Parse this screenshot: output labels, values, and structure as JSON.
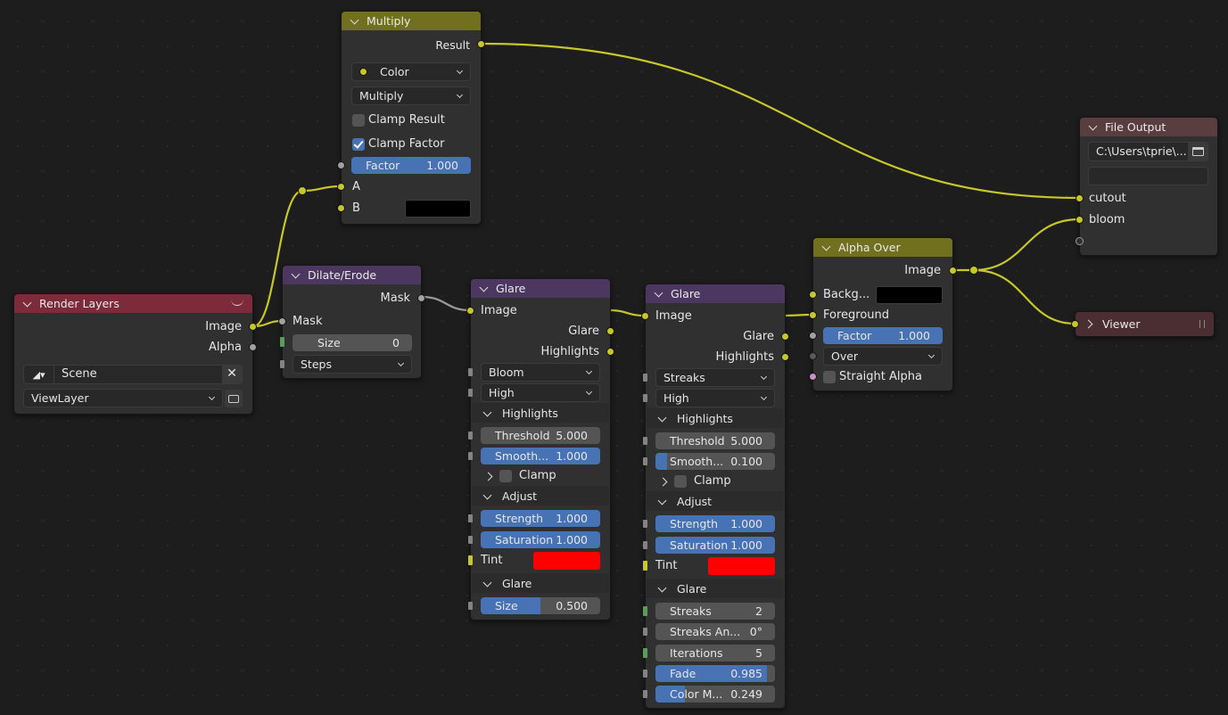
{
  "colors": {
    "background": "#1d1d1d",
    "node_body": "#303030",
    "header_math": "#71701f",
    "header_input": "#7d2a3b",
    "header_filter": "#4c3761",
    "header_output": "#5a3d3f",
    "header_viewer": "#4a2e31",
    "socket_color": "#c7c729",
    "socket_float": "#a1a1a1",
    "socket_shader": "#cc8ec7",
    "slider_blue": "#4772b3",
    "field_grey": "#545454",
    "wire_color": "#c7c729",
    "wire_float": "#9a9a9a",
    "tint_red": "#ff0000",
    "black": "#000000"
  },
  "multiply": {
    "title": "Multiply",
    "output_result": "Result",
    "data_type": "Color",
    "blend_mode": "Multiply",
    "clamp_result_label": "Clamp Result",
    "clamp_result_checked": false,
    "clamp_factor_label": "Clamp Factor",
    "clamp_factor_checked": true,
    "factor_label": "Factor",
    "factor_value": "1.000",
    "input_a": "A",
    "input_b": "B"
  },
  "render_layers": {
    "title": "Render Layers",
    "output_image": "Image",
    "output_alpha": "Alpha",
    "scene": "Scene",
    "view_layer": "ViewLayer"
  },
  "dilate": {
    "title": "Dilate/Erode",
    "output_mask": "Mask",
    "input_mask": "Mask",
    "size_label": "Size",
    "size_value": "0",
    "mode": "Steps"
  },
  "glare1": {
    "title": "Glare",
    "input_image": "Image",
    "output_glare": "Glare",
    "output_highlights": "Highlights",
    "glare_type": "Bloom",
    "quality": "High",
    "highlights_panel": "Highlights",
    "threshold_label": "Threshold",
    "threshold_value": "5.000",
    "smooth_label": "Smooth...",
    "smooth_value": "1.000",
    "clamp_label": "Clamp",
    "adjust_panel": "Adjust",
    "strength_label": "Strength",
    "strength_value": "1.000",
    "saturation_label": "Saturation",
    "saturation_value": "1.000",
    "tint_label": "Tint",
    "glare_panel": "Glare",
    "size_label": "Size",
    "size_value": "0.500",
    "size_fraction": 0.5
  },
  "glare2": {
    "title": "Glare",
    "input_image": "Image",
    "output_glare": "Glare",
    "output_highlights": "Highlights",
    "glare_type": "Streaks",
    "quality": "High",
    "highlights_panel": "Highlights",
    "threshold_label": "Threshold",
    "threshold_value": "5.000",
    "smooth_label": "Smooth...",
    "smooth_value": "0.100",
    "smooth_fraction": 0.1,
    "clamp_label": "Clamp",
    "adjust_panel": "Adjust",
    "strength_label": "Strength",
    "strength_value": "1.000",
    "saturation_label": "Saturation",
    "saturation_value": "1.000",
    "tint_label": "Tint",
    "glare_panel": "Glare",
    "streaks_label": "Streaks",
    "streaks_value": "2",
    "streaks_angle_label": "Streaks An...",
    "streaks_angle_value": "0°",
    "iterations_label": "Iterations",
    "iterations_value": "5",
    "fade_label": "Fade",
    "fade_value": "0.985",
    "fade_fraction": 0.93,
    "color_mod_label": "Color M...",
    "color_mod_value": "0.249",
    "color_mod_fraction": 0.249
  },
  "alpha_over": {
    "title": "Alpha Over",
    "output_image": "Image",
    "input_background": "Backg...",
    "input_foreground": "Foreground",
    "factor_label": "Factor",
    "factor_value": "1.000",
    "mode": "Over",
    "straight_alpha_label": "Straight Alpha"
  },
  "file_output": {
    "title": "File Output",
    "path": "C:\\Users\\tprie\\...",
    "input_cutout": "cutout",
    "input_bloom": "bloom"
  },
  "viewer": {
    "title": "Viewer"
  }
}
